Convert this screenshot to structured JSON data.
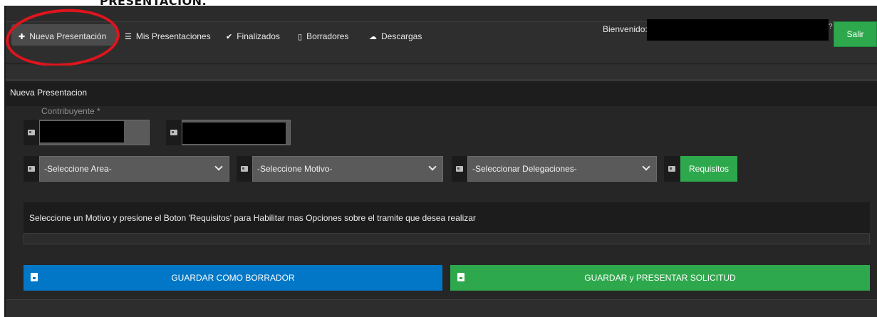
{
  "page": {
    "heading_fragment": "PRESENTACION."
  },
  "nav": {
    "items": [
      {
        "icon": "plus-icon",
        "label": "Nueva Presentación"
      },
      {
        "icon": "list-icon",
        "label": "Mis Presentaciones"
      },
      {
        "icon": "check-circle-icon",
        "label": "Finalizados"
      },
      {
        "icon": "file-icon",
        "label": "Borradores"
      },
      {
        "icon": "cloud-download-icon",
        "label": "Descargas"
      }
    ],
    "welcome_label": "Bienvenido:",
    "logout_label": "Salir"
  },
  "panel": {
    "title": "Nueva Presentacion",
    "contribuyente_label": "Contribuyente *",
    "selects": {
      "area": "-Seleccione Area-",
      "motivo": "-Seleccione Motivo-",
      "delegaciones": "-Seleccionar Delegaciones-"
    },
    "requisitos_label": "Requisitos",
    "info_message": "Seleccione un Motivo y presione el Boton 'Requisitos' para Habilitar mas Opciones sobre el tramite que desea realizar",
    "draft_button": "GUARDAR COMO BORRADOR",
    "submit_button": "GUARDAR y PRESENTAR SOLICITUD"
  },
  "colors": {
    "accent_green": "#2ea84c",
    "accent_blue": "#0277c7",
    "annotation_red": "#e0141d",
    "panel_dark": "#1d1d1d"
  }
}
